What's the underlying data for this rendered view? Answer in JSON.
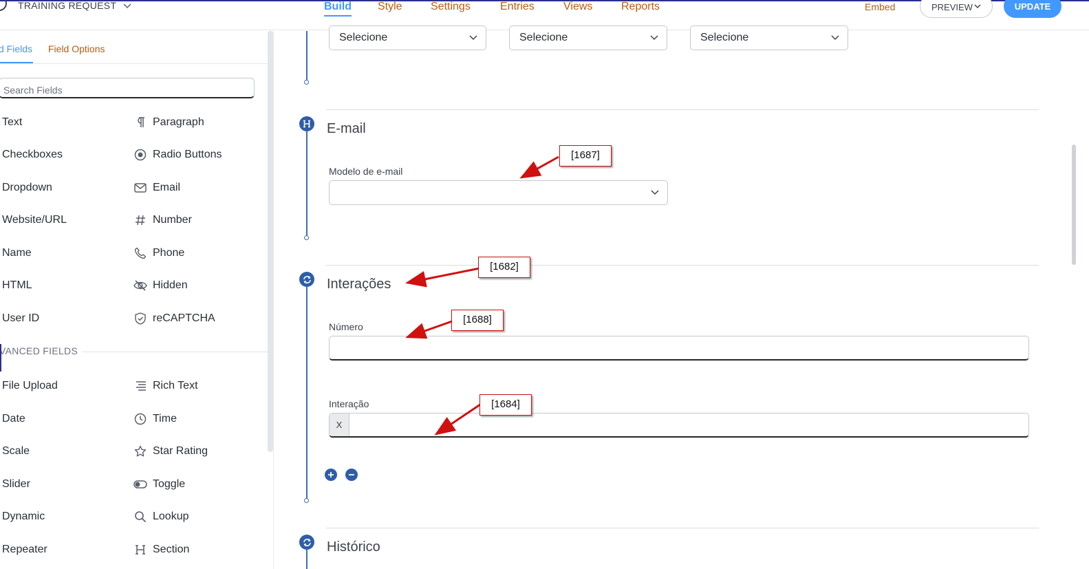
{
  "header": {
    "form_name": "TRAINING REQUEST",
    "nav": [
      "Build",
      "Style",
      "Settings",
      "Entries",
      "Views",
      "Reports"
    ],
    "active_nav": "Build",
    "embed_label": "Embed",
    "preview_label": "PREVIEW",
    "update_label": "UPDATE"
  },
  "sidebar": {
    "tabs": [
      "d Fields",
      "Field Options"
    ],
    "search_placeholder": "Search Fields",
    "basic_fields": [
      {
        "label": "Text",
        "icon": "text-icon"
      },
      {
        "label": "Paragraph",
        "icon": "paragraph-icon"
      },
      {
        "label": "Checkboxes",
        "icon": "checkbox-icon"
      },
      {
        "label": "Radio Buttons",
        "icon": "radio-icon"
      },
      {
        "label": "Dropdown",
        "icon": "dropdown-icon"
      },
      {
        "label": "Email",
        "icon": "envelope-icon"
      },
      {
        "label": "Website/URL",
        "icon": "link-icon"
      },
      {
        "label": "Number",
        "icon": "hash-icon"
      },
      {
        "label": "Name",
        "icon": "user-icon"
      },
      {
        "label": "Phone",
        "icon": "phone-icon"
      },
      {
        "label": "HTML",
        "icon": "code-icon"
      },
      {
        "label": "Hidden",
        "icon": "eye-slash-icon"
      },
      {
        "label": "User ID",
        "icon": "id-icon"
      },
      {
        "label": "reCAPTCHA",
        "icon": "shield-check-icon"
      }
    ],
    "advanced_title": "VANCED FIELDS",
    "advanced_fields": [
      {
        "label": "File Upload",
        "icon": "upload-icon"
      },
      {
        "label": "Rich Text",
        "icon": "rich-text-icon"
      },
      {
        "label": "Date",
        "icon": "calendar-icon"
      },
      {
        "label": "Time",
        "icon": "clock-icon"
      },
      {
        "label": "Scale",
        "icon": "scale-icon"
      },
      {
        "label": "Star Rating",
        "icon": "star-icon"
      },
      {
        "label": "Slider",
        "icon": "slider-icon"
      },
      {
        "label": "Toggle",
        "icon": "toggle-icon"
      },
      {
        "label": "Dynamic",
        "icon": "dynamic-icon"
      },
      {
        "label": "Lookup",
        "icon": "magnifier-icon"
      },
      {
        "label": "Repeater",
        "icon": "repeater-icon"
      },
      {
        "label": "Section",
        "icon": "section-h-icon"
      }
    ]
  },
  "canvas": {
    "top_selects": [
      "Selecione",
      "Selecione",
      "Selecione"
    ],
    "email_section": {
      "title": "E-mail",
      "field_label": "Modelo de e-mail",
      "field_value": ""
    },
    "interactions_section": {
      "title": "Interações",
      "numero_label": "Número",
      "numero_value": "",
      "interacao_label": "Interação",
      "interacao_prefix": "X",
      "interacao_value": ""
    },
    "history_section": {
      "title": "Histórico"
    }
  },
  "annotations": [
    {
      "text": "[1687]"
    },
    {
      "text": "[1682]"
    },
    {
      "text": "[1688]"
    },
    {
      "text": "[1684]"
    }
  ],
  "colors": {
    "accent_blue": "#4199fd",
    "nav_orange": "#b85c12",
    "section_icon_blue": "#2e5ea8",
    "annotation_red": "#d11010"
  }
}
